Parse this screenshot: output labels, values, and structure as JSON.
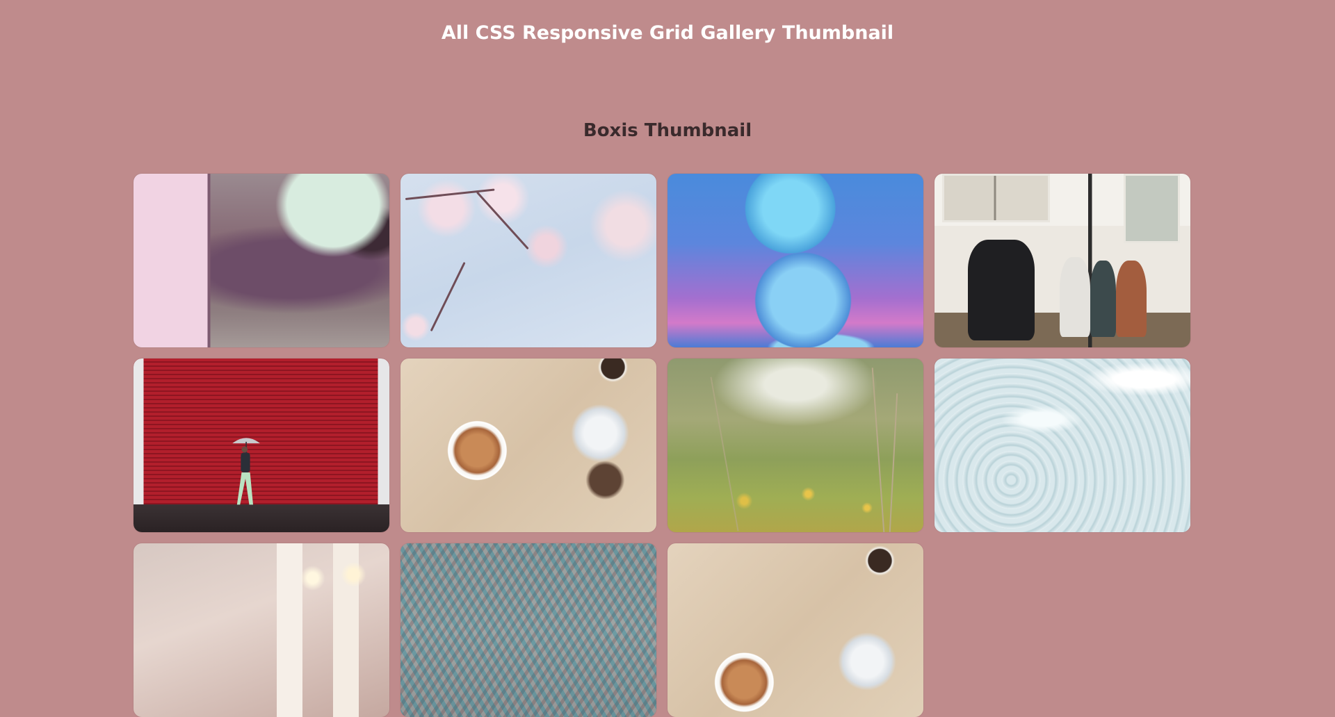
{
  "header": {
    "title": "All CSS Responsive Grid Gallery Thumbnail"
  },
  "section": {
    "title": "Boxis Thumbnail"
  },
  "colors": {
    "background": "#bf8b8c",
    "title_text": "#ffffff",
    "section_text": "#3a2a2c"
  },
  "gallery": {
    "items": [
      {
        "name": "thumbnail-blurred-pink"
      },
      {
        "name": "thumbnail-cherry-blossom"
      },
      {
        "name": "thumbnail-glass-spheres"
      },
      {
        "name": "thumbnail-kids-stroller"
      },
      {
        "name": "thumbnail-red-shutter-umbrella"
      },
      {
        "name": "thumbnail-coffee-milk"
      },
      {
        "name": "thumbnail-meadow-grass"
      },
      {
        "name": "thumbnail-ocean-water"
      },
      {
        "name": "thumbnail-candles-book"
      },
      {
        "name": "thumbnail-frost-pattern"
      },
      {
        "name": "thumbnail-coffee-milk-2"
      }
    ]
  }
}
